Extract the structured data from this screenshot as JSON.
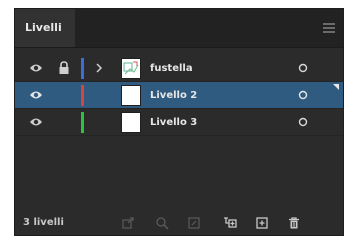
{
  "panel": {
    "tab_label": "Livelli",
    "menu_icon": "panel-menu-icon"
  },
  "layers": [
    {
      "name": "fustella",
      "color": "#3a6fd8",
      "visible": true,
      "locked": true,
      "expandable": true,
      "selected": false,
      "thumbnail": "artwork-thumbnail"
    },
    {
      "name": "Livello 2",
      "color": "#d9453a",
      "visible": true,
      "locked": false,
      "expandable": false,
      "selected": true,
      "thumbnail": "blank-thumbnail"
    },
    {
      "name": "Livello 3",
      "color": "#2cc43a",
      "visible": true,
      "locked": false,
      "expandable": false,
      "selected": false,
      "thumbnail": "blank-thumbnail"
    }
  ],
  "footer": {
    "count_label": "3 livelli",
    "icons": [
      "export-icon",
      "locate-object-icon",
      "clipping-mask-icon",
      "new-sublayer-icon",
      "new-layer-icon",
      "delete-icon"
    ]
  },
  "colors": {
    "panel_bg": "#2b2b2b",
    "selected_row": "#2f5b80",
    "text": "#e6e6e6"
  }
}
